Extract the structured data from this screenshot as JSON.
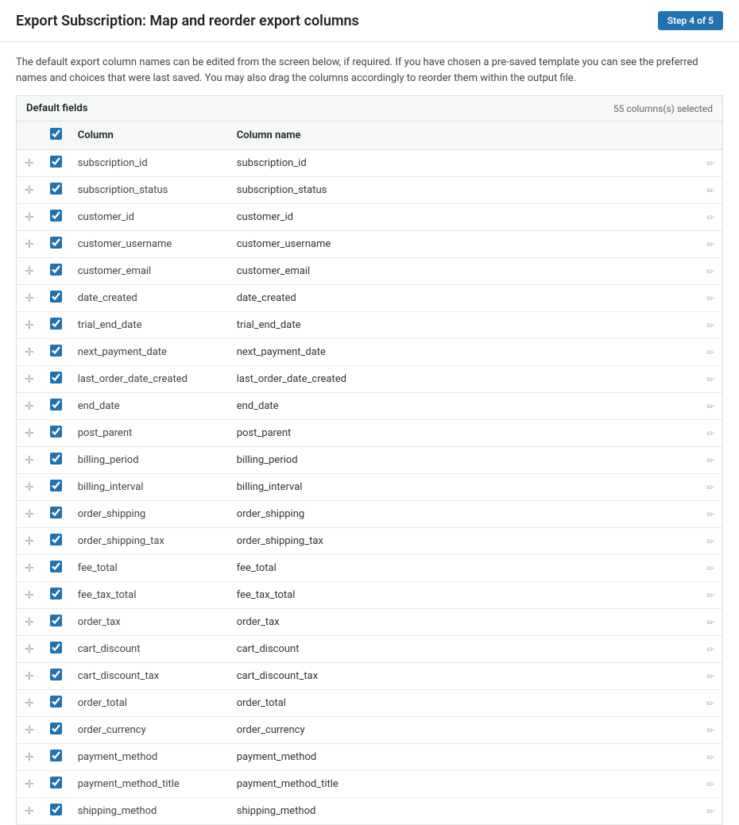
{
  "header": {
    "title": "Export Subscription: Map and reorder export columns",
    "step": "Step 4 of 5"
  },
  "description": "The default export column names can be edited from the screen below, if required. If you have chosen a pre-saved template you can see the preferred names and choices that were last saved. You may also drag the columns accordingly to reorder them within the output file.",
  "table": {
    "section_title": "Default fields",
    "columns_selected": "55 columns(s) selected",
    "col_header_column": "Column",
    "col_header_column_name": "Column name",
    "rows": [
      {
        "id": "subscription_id",
        "column": "subscription_id",
        "column_name": "subscription_id",
        "checked": true
      },
      {
        "id": "subscription_status",
        "column": "subscription_status",
        "column_name": "subscription_status",
        "checked": true
      },
      {
        "id": "customer_id",
        "column": "customer_id",
        "column_name": "customer_id",
        "checked": true
      },
      {
        "id": "customer_username",
        "column": "customer_username",
        "column_name": "customer_username",
        "checked": true
      },
      {
        "id": "customer_email",
        "column": "customer_email",
        "column_name": "customer_email",
        "checked": true
      },
      {
        "id": "date_created",
        "column": "date_created",
        "column_name": "date_created",
        "checked": true
      },
      {
        "id": "trial_end_date",
        "column": "trial_end_date",
        "column_name": "trial_end_date",
        "checked": true
      },
      {
        "id": "next_payment_date",
        "column": "next_payment_date",
        "column_name": "next_payment_date",
        "checked": true
      },
      {
        "id": "last_order_date_created",
        "column": "last_order_date_created",
        "column_name": "last_order_date_created",
        "checked": true
      },
      {
        "id": "end_date",
        "column": "end_date",
        "column_name": "end_date",
        "checked": true
      },
      {
        "id": "post_parent",
        "column": "post_parent",
        "column_name": "post_parent",
        "checked": true
      },
      {
        "id": "billing_period",
        "column": "billing_period",
        "column_name": "billing_period",
        "checked": true
      },
      {
        "id": "billing_interval",
        "column": "billing_interval",
        "column_name": "billing_interval",
        "checked": true
      },
      {
        "id": "order_shipping",
        "column": "order_shipping",
        "column_name": "order_shipping",
        "checked": true
      },
      {
        "id": "order_shipping_tax",
        "column": "order_shipping_tax",
        "column_name": "order_shipping_tax",
        "checked": true
      },
      {
        "id": "fee_total",
        "column": "fee_total",
        "column_name": "fee_total",
        "checked": true
      },
      {
        "id": "fee_tax_total",
        "column": "fee_tax_total",
        "column_name": "fee_tax_total",
        "checked": true
      },
      {
        "id": "order_tax",
        "column": "order_tax",
        "column_name": "order_tax",
        "checked": true
      },
      {
        "id": "cart_discount",
        "column": "cart_discount",
        "column_name": "cart_discount",
        "checked": true
      },
      {
        "id": "cart_discount_tax",
        "column": "cart_discount_tax",
        "column_name": "cart_discount_tax",
        "checked": true
      },
      {
        "id": "order_total",
        "column": "order_total",
        "column_name": "order_total",
        "checked": true
      },
      {
        "id": "order_currency",
        "column": "order_currency",
        "column_name": "order_currency",
        "checked": true
      },
      {
        "id": "payment_method",
        "column": "payment_method",
        "column_name": "payment_method",
        "checked": true
      },
      {
        "id": "payment_method_title",
        "column": "payment_method_title",
        "column_name": "payment_method_title",
        "checked": true
      },
      {
        "id": "shipping_method",
        "column": "shipping_method",
        "column_name": "shipping_method",
        "checked": true
      }
    ]
  }
}
